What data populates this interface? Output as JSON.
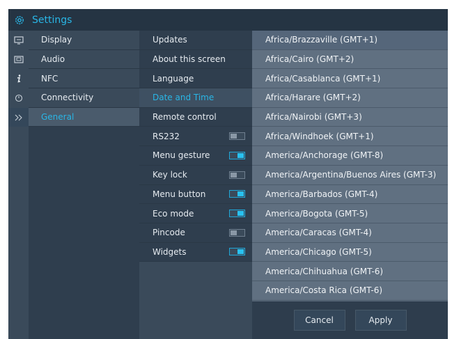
{
  "header": {
    "title": "Settings",
    "icon": "gear-icon"
  },
  "rail": {
    "icons": [
      "display-icon",
      "audio-icon",
      "info-icon",
      "power-icon",
      "double-chevron-right-icon"
    ]
  },
  "menu": {
    "items": [
      {
        "label": "Display"
      },
      {
        "label": "Audio"
      },
      {
        "label": "NFC"
      },
      {
        "label": "Connectivity"
      },
      {
        "label": "General"
      }
    ],
    "selected": "General"
  },
  "general": {
    "items": [
      {
        "label": "Updates"
      },
      {
        "label": "About this screen"
      },
      {
        "label": "Language"
      },
      {
        "label": "Date and Time"
      },
      {
        "label": "Remote control"
      },
      {
        "label": "RS232",
        "toggle": "off"
      },
      {
        "label": "Menu gesture",
        "toggle": "on"
      },
      {
        "label": "Key lock",
        "toggle": "off"
      },
      {
        "label": "Menu button",
        "toggle": "on"
      },
      {
        "label": "Eco mode",
        "toggle": "on"
      },
      {
        "label": "Pincode",
        "toggle": "off"
      },
      {
        "label": "Widgets",
        "toggle": "on"
      }
    ],
    "selected": "Date and Time"
  },
  "timezones": {
    "items": [
      "Africa/Brazzaville (GMT+1)",
      "Africa/Cairo (GMT+2)",
      "Africa/Casablanca (GMT+1)",
      "Africa/Harare (GMT+2)",
      "Africa/Nairobi (GMT+3)",
      "Africa/Windhoek (GMT+1)",
      "America/Anchorage (GMT-8)",
      "America/Argentina/Buenos Aires (GMT-3)",
      "America/Barbados (GMT-4)",
      "America/Bogota (GMT-5)",
      "America/Caracas (GMT-4)",
      "America/Chicago (GMT-5)",
      "America/Chihuahua (GMT-6)",
      "America/Costa Rica (GMT-6)"
    ]
  },
  "footer": {
    "cancel_label": "Cancel",
    "apply_label": "Apply"
  },
  "colors": {
    "accent": "#29b6e6",
    "toggle_on": "#29c1f0",
    "background": "#2e3d4d"
  }
}
